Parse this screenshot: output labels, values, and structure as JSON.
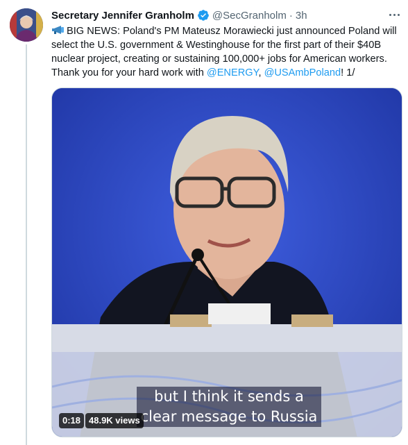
{
  "tweet": {
    "author_name": "Secretary Jennifer Granholm",
    "handle": "@SecGranholm",
    "separator": "·",
    "time": "3h",
    "text_parts": {
      "main": "BIG NEWS: Poland's PM Mateusz Morawiecki just announced Poland will select the U.S. government & Westinghouse for the first part of their $40B nuclear project, creating or sustaining 100,000+ jobs for American workers. Thank you for your hard work with ",
      "mention1": "@ENERGY",
      "comma": ", ",
      "mention2": "@USAmbPoland",
      "end": "! 1/"
    },
    "video": {
      "subtitle_line1": "but I think it sends a",
      "subtitle_line2": "clear message to Russia",
      "time_elapsed": "0:18",
      "views": "48.9K views"
    },
    "icons": [
      "verified-badge-icon",
      "more-options-icon",
      "megaphone-icon"
    ],
    "colors": {
      "link": "#1d9bf0",
      "verified": "#1d9bf0",
      "video_bg": "#1c3fbf"
    }
  }
}
